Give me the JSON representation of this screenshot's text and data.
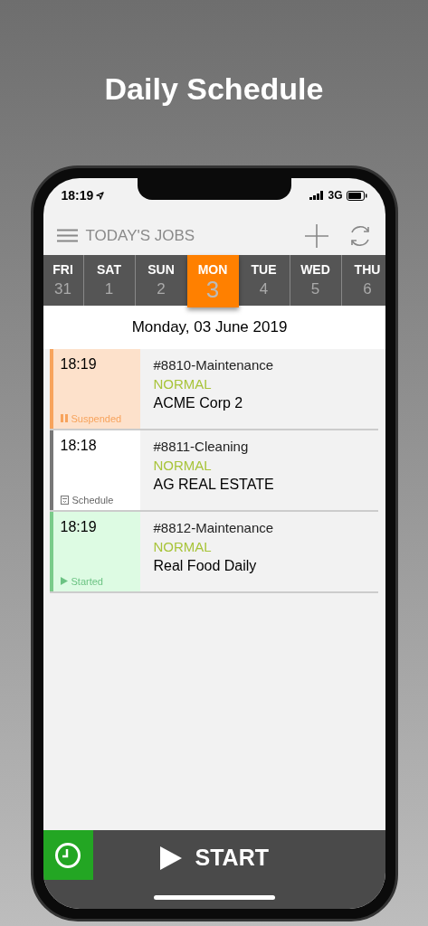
{
  "page_title": "Daily Schedule",
  "status_bar": {
    "time": "18:19",
    "network": "3G"
  },
  "header": {
    "title": "TODAY'S JOBS"
  },
  "days": [
    {
      "name": "FRI",
      "date": "31",
      "selected": false
    },
    {
      "name": "SAT",
      "date": "1",
      "selected": false
    },
    {
      "name": "SUN",
      "date": "2",
      "selected": false
    },
    {
      "name": "MON",
      "date": "3",
      "selected": true
    },
    {
      "name": "TUE",
      "date": "4",
      "selected": false
    },
    {
      "name": "WED",
      "date": "5",
      "selected": false
    },
    {
      "name": "THU",
      "date": "6",
      "selected": false
    }
  ],
  "date_heading": "Monday, 03 June 2019",
  "jobs": [
    {
      "time": "18:19",
      "kind": "suspended",
      "status": "Suspended",
      "title": "#8810-Maintenance",
      "priority": "NORMAL",
      "client": "ACME Corp 2"
    },
    {
      "time": "18:18",
      "kind": "schedule",
      "status": "Schedule",
      "title": "#8811-Cleaning",
      "priority": "NORMAL",
      "client": "AG REAL ESTATE"
    },
    {
      "time": "18:19",
      "kind": "started",
      "status": "Started",
      "title": "#8812-Maintenance",
      "priority": "NORMAL",
      "client": "Real Food Daily"
    }
  ],
  "start_button": "START"
}
